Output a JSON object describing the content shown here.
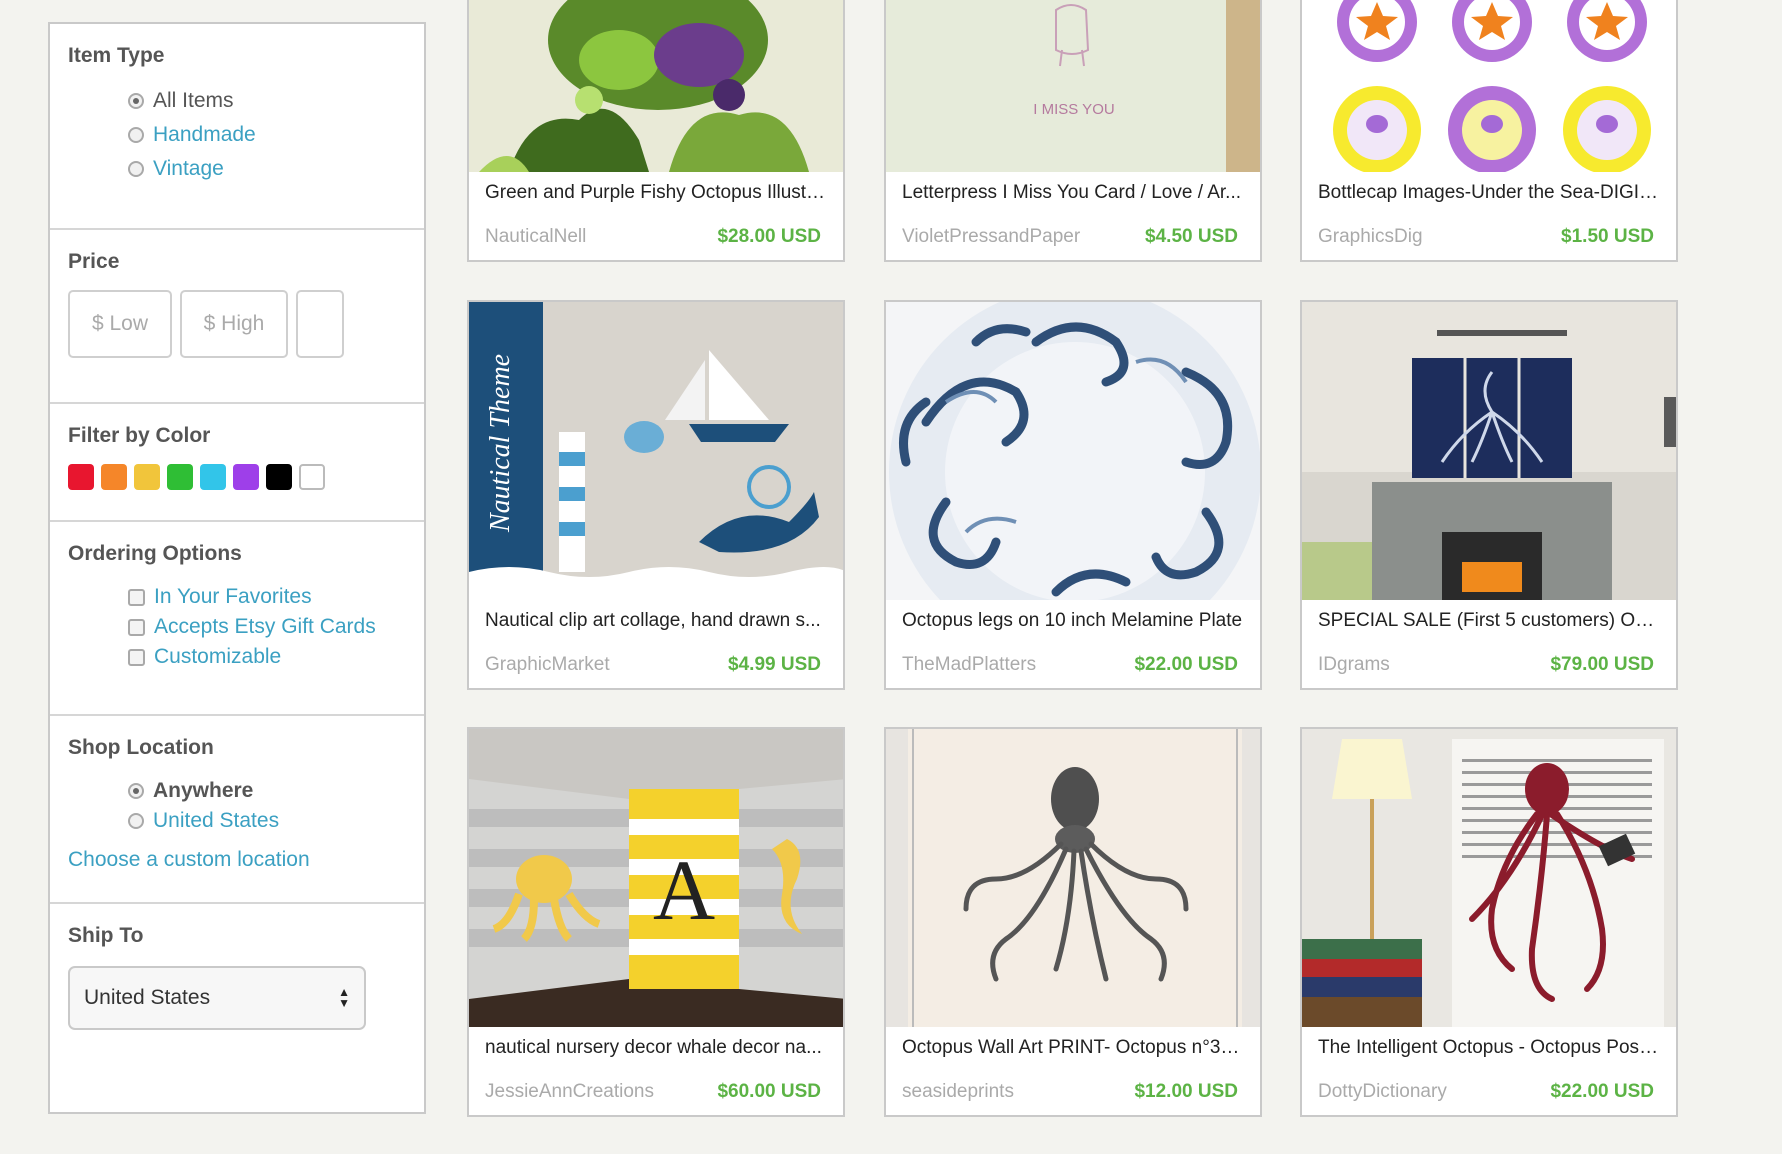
{
  "sidebar": {
    "item_type": {
      "title": "Item Type",
      "options": [
        {
          "label": "All Items",
          "selected": true
        },
        {
          "label": "Handmade",
          "selected": false
        },
        {
          "label": "Vintage",
          "selected": false
        }
      ]
    },
    "price": {
      "title": "Price",
      "low_placeholder": "$ Low",
      "high_placeholder": "$ High"
    },
    "color": {
      "title": "Filter by Color",
      "swatches": [
        "#e8162f",
        "#f58629",
        "#f1c53b",
        "#2fbe35",
        "#32c5e9",
        "#9e3fe9",
        "#000000",
        "#ffffff"
      ]
    },
    "ordering": {
      "title": "Ordering Options",
      "options": [
        "In Your Favorites",
        "Accepts Etsy Gift Cards",
        "Customizable"
      ]
    },
    "location": {
      "title": "Shop Location",
      "options": [
        {
          "label": "Anywhere",
          "selected": true
        },
        {
          "label": "United States",
          "selected": false
        }
      ],
      "custom": "Choose a custom location"
    },
    "ship_to": {
      "title": "Ship To",
      "value": "United States"
    }
  },
  "listings": [
    {
      "title": "Green and Purple Fishy Octopus Illustr...",
      "shop": "NauticalNell",
      "price": "$28.00 USD"
    },
    {
      "title": "Letterpress I Miss You Card / Love / Ar...",
      "shop": "VioletPressandPaper",
      "price": "$4.50 USD",
      "image_text": "I MISS YOU"
    },
    {
      "title": "Bottlecap Images-Under the Sea-DIGIT...",
      "shop": "GraphicsDig",
      "price": "$1.50 USD"
    },
    {
      "title": "Nautical clip art collage, hand drawn s...",
      "shop": "GraphicMarket",
      "price": "$4.99 USD",
      "image_text": "Nautical Theme"
    },
    {
      "title": "Octopus legs on 10 inch Melamine Plate",
      "shop": "TheMadPlatters",
      "price": "$22.00 USD"
    },
    {
      "title": "SPECIAL SALE (First 5 customers) Oct...",
      "shop": "IDgrams",
      "price": "$79.00 USD"
    },
    {
      "title": "nautical nursery decor whale decor na...",
      "shop": "JessieAnnCreations",
      "price": "$60.00 USD",
      "image_text": "A"
    },
    {
      "title": "Octopus Wall Art PRINT- Octopus n°32...",
      "shop": "seasideprints",
      "price": "$12.00 USD"
    },
    {
      "title": "The Intelligent Octopus - Octopus Post...",
      "shop": "DottyDictionary",
      "price": "$22.00 USD"
    }
  ]
}
